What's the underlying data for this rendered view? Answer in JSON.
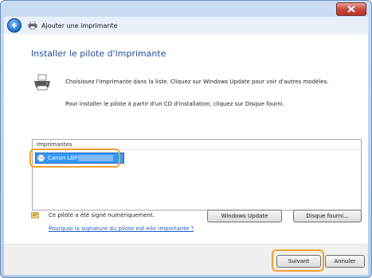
{
  "window": {
    "title": "Ajouter une imprimante",
    "close_icon": "close-icon"
  },
  "main": {
    "heading": "Installer le pilote d'imprimante",
    "instruction_1": "Choisissez l'imprimante dans la liste. Cliquez sur Windows Update pour voir d'autres modèles.",
    "instruction_2": "Pour installer le pilote à partir d'un CD d'installation, cliquez sur Disque fourni."
  },
  "printer_list": {
    "header": "Imprimantes",
    "items": [
      {
        "label": "Canon LBP",
        "selected": true
      }
    ]
  },
  "signature": {
    "text": "Ce pilote a été signé numériquement.",
    "link": "Pourquoi la signature du pilote est-elle importante ?"
  },
  "buttons": {
    "windows_update": "Windows Update",
    "have_disk": "Disque fourni...",
    "next": "Suivant",
    "cancel": "Annuler"
  },
  "colors": {
    "heading": "#1e4f9c",
    "selection": "#3399ff",
    "highlight": "#f0a030",
    "link": "#1e5bc6"
  }
}
